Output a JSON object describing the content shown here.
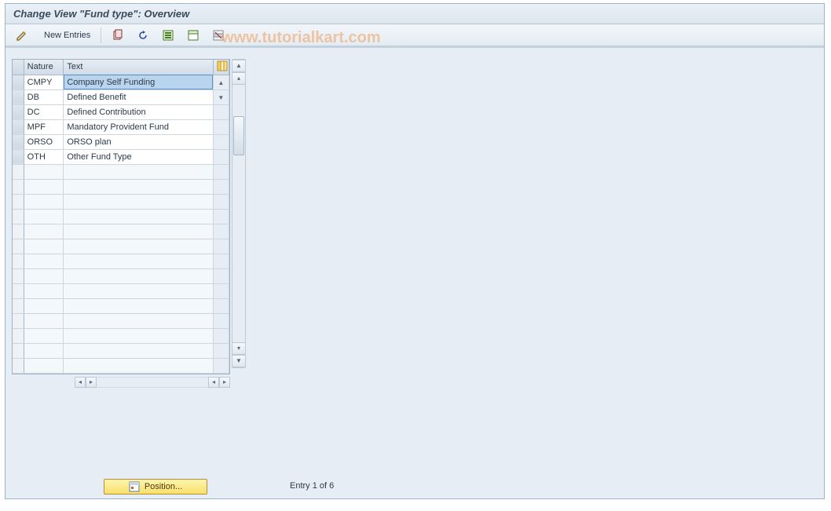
{
  "title": "Change View \"Fund type\": Overview",
  "watermark": "www.tutorialkart.com",
  "toolbar": {
    "new_entries": "New Entries"
  },
  "grid": {
    "columns": {
      "nature": "Nature",
      "text": "Text"
    },
    "rows": [
      {
        "nature": "CMPY",
        "text": "Company Self Funding"
      },
      {
        "nature": "DB",
        "text": "Defined Benefit"
      },
      {
        "nature": "DC",
        "text": "Defined Contribution"
      },
      {
        "nature": "MPF",
        "text": "Mandatory Provident Fund"
      },
      {
        "nature": "ORSO",
        "text": "ORSO plan"
      },
      {
        "nature": "OTH",
        "text": "Other Fund Type"
      }
    ],
    "empty_row_count": 14,
    "selected": {
      "row": 0,
      "col": "text"
    }
  },
  "footer": {
    "position_button": "Position...",
    "entry_text": "Entry 1 of 6"
  }
}
